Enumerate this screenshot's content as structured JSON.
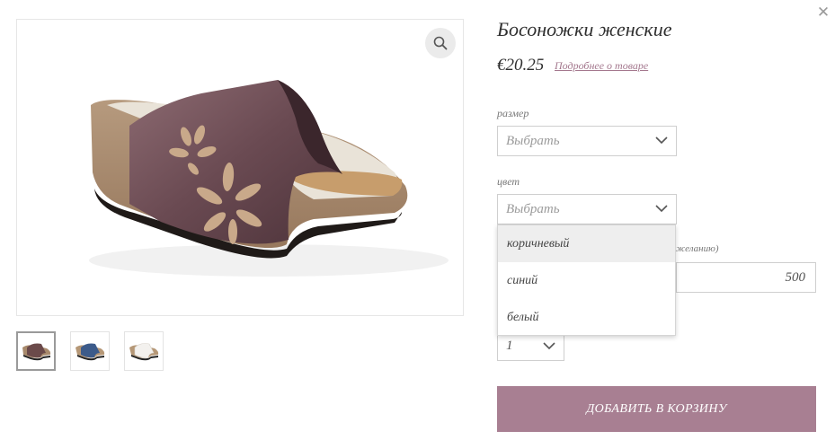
{
  "product": {
    "title": "Босоножки женские",
    "price": "€20.25",
    "details_link": "Подробнее о товаре"
  },
  "gallery": {
    "main_image": "brown wedge sandal with flower cutouts",
    "thumbnails": [
      {
        "name": "thumbnail-brown",
        "color": "#6b4a4a",
        "active": true
      },
      {
        "name": "thumbnail-blue",
        "color": "#3c5b8a",
        "active": false
      },
      {
        "name": "thumbnail-white",
        "color": "#f3f1ee",
        "active": false
      }
    ]
  },
  "options": {
    "size_label": "размер",
    "size_placeholder": "Выбрать",
    "color_label": "цвет",
    "color_placeholder": "Выбрать",
    "color_options": [
      "коричневый",
      "синий",
      "белый"
    ],
    "amount_label_visible": "желанию)",
    "amount_value": "500",
    "quantity_value": "1"
  },
  "actions": {
    "add_to_cart": "ДОБАВИТЬ В КОРЗИНУ"
  },
  "icons": {
    "close": "close-icon",
    "zoom": "magnifier-icon",
    "chevron": "chevron-down-icon"
  },
  "colors": {
    "accent_button": "#a87f92",
    "link": "#a4788e"
  }
}
